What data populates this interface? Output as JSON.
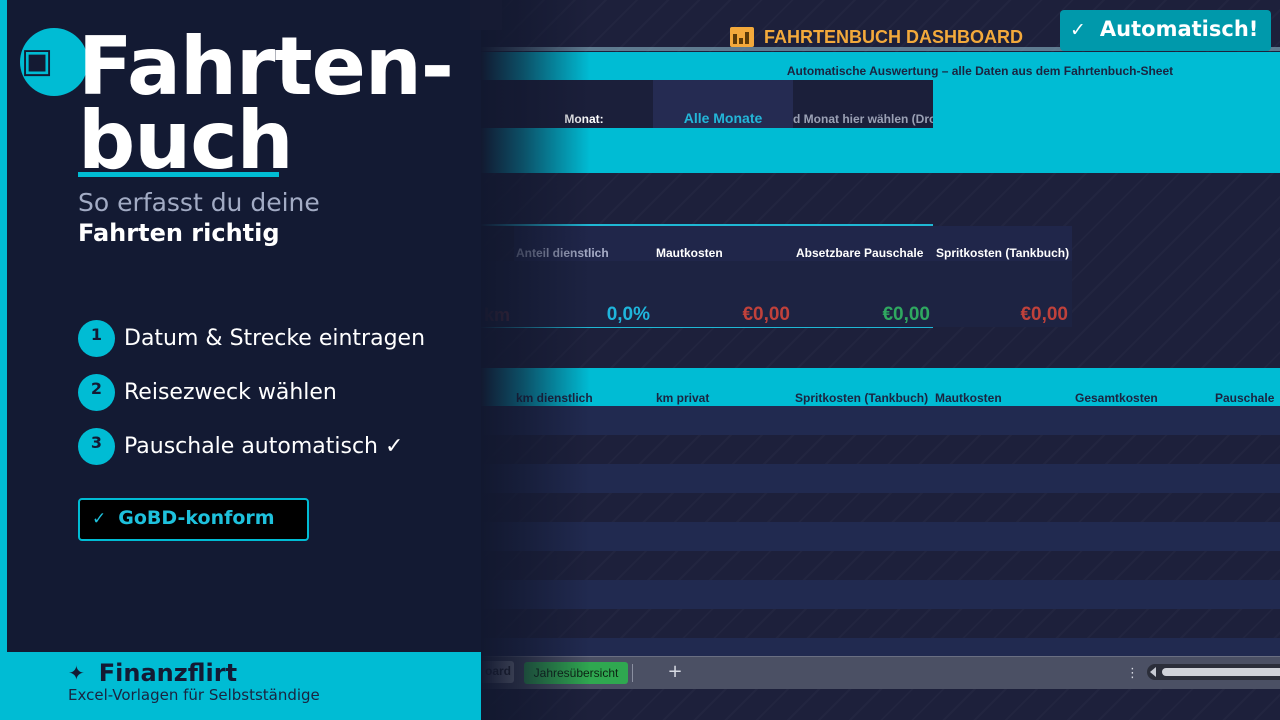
{
  "promo": {
    "logo_icon": "car-icon",
    "headline_line1": "Fahrten-",
    "headline_line2": "buch",
    "tagline_line1": "So erfasst du deine",
    "tagline_line2": "Fahrten richtig",
    "steps": [
      {
        "number": "1",
        "text": "Datum & Strecke eintragen"
      },
      {
        "number": "2",
        "text": "Reisezweck wählen"
      },
      {
        "number": "3",
        "text": "Pauschale automatisch ✓"
      }
    ],
    "badge_check": "✓",
    "badge_label": "GoBD-konform",
    "auto_check": "✓",
    "auto_label": "Automatisch!"
  },
  "footer": {
    "brand_icon": "sparkle-icon",
    "brand_star": "✦",
    "brand_name": "Finanzflirt",
    "brand_tagline": "Excel-Vorlagen für Selbstständige"
  },
  "dashboard": {
    "title": "FAHRTENBUCH DASHBOARD",
    "subtitle": "Automatische Auswertung – alle Daten aus dem Fahrtenbuch-Sheet",
    "month_label": "Monat:",
    "month_value": "Alle Monate",
    "month_hint": "d Monat hier wählen (Dropdown)",
    "kpis": [
      {
        "header": "Anteil dienstlich",
        "value": "0,0%",
        "color": "#1fb5dc"
      },
      {
        "header": "Mautkosten",
        "value": "€0,00",
        "color": "#c0413b"
      },
      {
        "header": "Absetzbare Pauschale",
        "value": "€0,00",
        "color": "#2fa860"
      },
      {
        "header": "Spritkosten (Tankbuch)",
        "value": "€0,00",
        "color": "#c0413b"
      }
    ],
    "partial_km": "km",
    "table_headers": [
      "km dienstlich",
      "km privat",
      "Spritkosten (Tankbuch)",
      "Mautkosten",
      "Gesamtkosten",
      "Pauschale"
    ]
  },
  "tabs": {
    "partial_tab": "oard",
    "year_tab": "Jahresübersicht",
    "add_sheet": "+",
    "more": "⋮"
  },
  "colors": {
    "accent": "#00bcd4",
    "panel_bg": "#131a33",
    "sheet_bg": "#1d203b",
    "title_orange": "#f3a93b"
  }
}
